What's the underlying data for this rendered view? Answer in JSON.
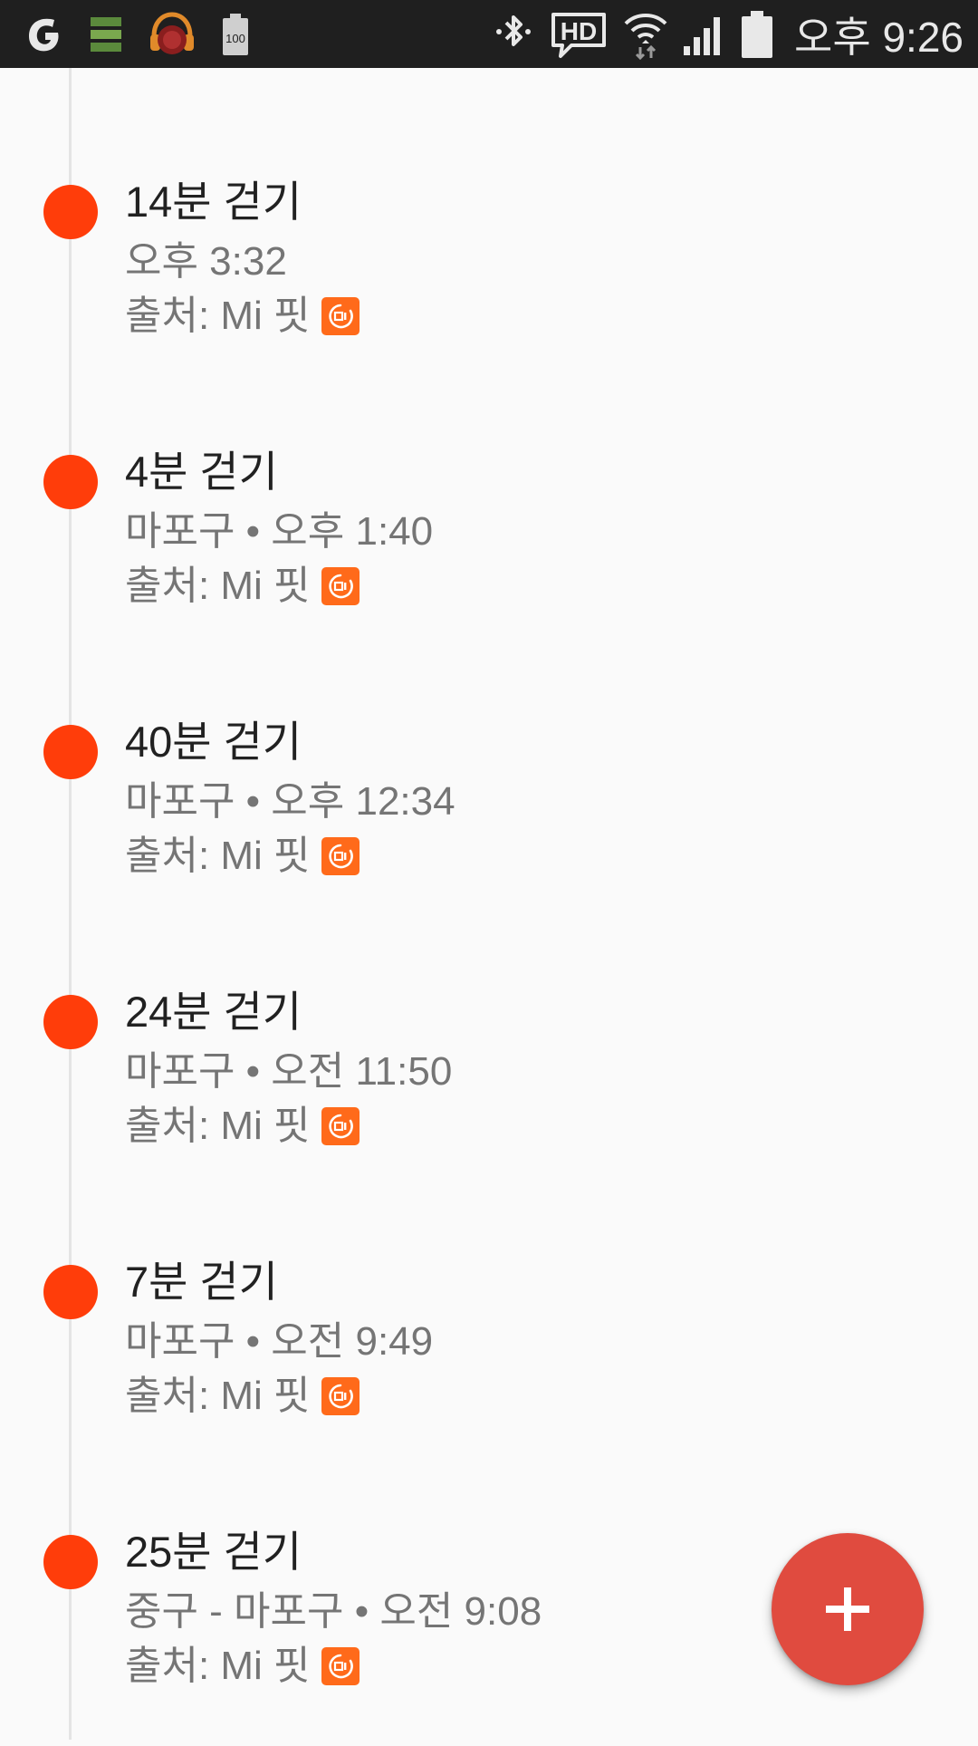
{
  "status_bar": {
    "battery_small_text": "100",
    "hd_label": "HD",
    "time": "오후 9:26"
  },
  "entries": [
    {
      "title": "14분 걷기",
      "subtitle": "오후 3:32",
      "source": "출처: Mi 핏"
    },
    {
      "title": "4분 걷기",
      "subtitle": "마포구 • 오후 1:40",
      "source": "출처: Mi 핏"
    },
    {
      "title": "40분 걷기",
      "subtitle": "마포구 • 오후 12:34",
      "source": "출처: Mi 핏"
    },
    {
      "title": "24분 걷기",
      "subtitle": "마포구 • 오전 11:50",
      "source": "출처: Mi 핏"
    },
    {
      "title": "7분 걷기",
      "subtitle": "마포구 • 오전 9:49",
      "source": "출처: Mi 핏"
    },
    {
      "title": "25분 걷기",
      "subtitle": "중구 - 마포구 • 오전 9:08",
      "source": "출처: Mi 핏"
    }
  ],
  "colors": {
    "dot": "#ff3d0a",
    "fab": "#e04b3f",
    "mi_badge": "#ff6a1a"
  },
  "icons": {
    "fab": "plus-icon",
    "source_badge": "mi-fit-icon"
  }
}
